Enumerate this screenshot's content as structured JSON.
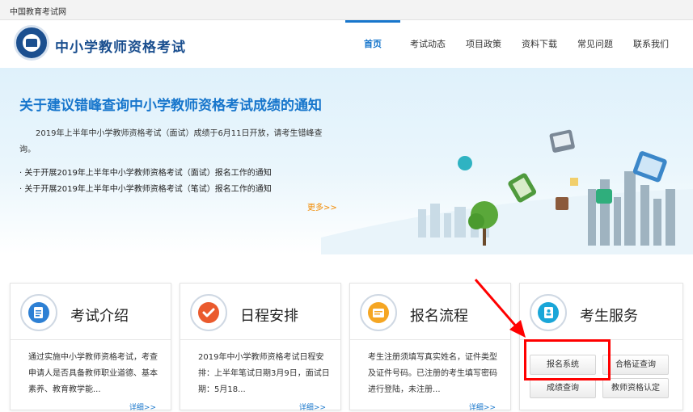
{
  "topbar": {
    "site_name": "中国教育考试网"
  },
  "header": {
    "title": "中小学教师资格考试",
    "nav": [
      "首页",
      "考试动态",
      "项目政策",
      "资料下载",
      "常见问题",
      "联系我们"
    ]
  },
  "banner": {
    "title": "关于建议错峰查询中小学教师资格考试成绩的通知",
    "desc": "2019年上半年中小学教师资格考试（面试）成绩于6月11日开放，请考生错峰查询。",
    "links": [
      "关于开展2019年上半年中小学教师资格考试（面试）报名工作的通知",
      "关于开展2019年上半年中小学教师资格考试（笔试）报名工作的通知"
    ],
    "more": "更多>>"
  },
  "cards": [
    {
      "title": "考试介绍",
      "body": "通过实施中小学教师资格考试，考查申请人是否具备教师职业道德、基本素养、教育教学能...",
      "more": "详细>>"
    },
    {
      "title": "日程安排",
      "body": "2019年中小学教师资格考试日程安排：上半年笔试日期3月9日，面试日期：5月18...",
      "more": "详细>>"
    },
    {
      "title": "报名流程",
      "body": "考生注册须填写真实姓名，证件类型及证件号码。已注册的考生填写密码进行登陆，未注册...",
      "more": "详细>>"
    },
    {
      "title": "考生服务"
    }
  ],
  "services": {
    "signup": "报名系统",
    "certificate_query": "合格证查询",
    "score_query": "成绩查询",
    "qualification": "教师资格认定"
  },
  "colors": {
    "accent": "#1776cc",
    "brand": "#1b4f8f",
    "highlight": "#ff0000",
    "more_link": "#f28a00"
  }
}
